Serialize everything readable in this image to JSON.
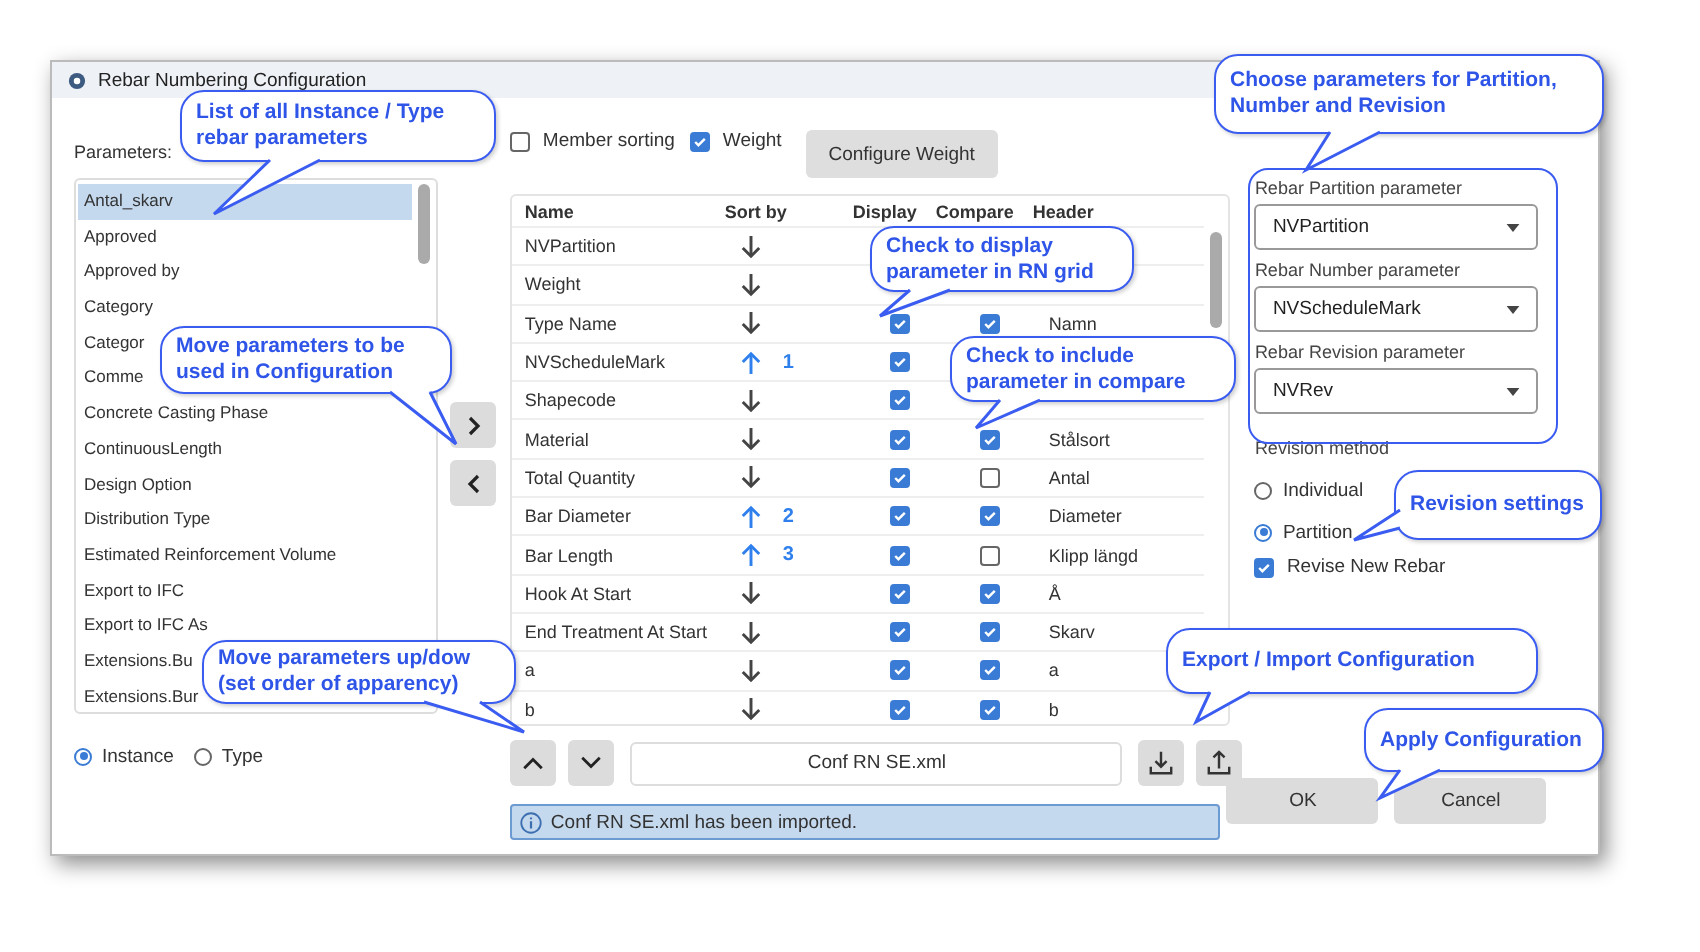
{
  "window": {
    "title": "Rebar Numbering Configuration"
  },
  "parameters": {
    "label": "Parameters:",
    "items": [
      {
        "text": "Antal_skarv",
        "selected": true
      },
      {
        "text": "Approved",
        "selected": false
      },
      {
        "text": "Approved by",
        "selected": false
      },
      {
        "text": "Category",
        "selected": false
      },
      {
        "text": "Categor",
        "selected": false
      },
      {
        "text": "Comme",
        "selected": false
      },
      {
        "text": "Concrete Casting Phase",
        "selected": false
      },
      {
        "text": "ContinuousLength",
        "selected": false
      },
      {
        "text": "Design Option",
        "selected": false
      },
      {
        "text": "Distribution Type",
        "selected": false
      },
      {
        "text": "Estimated Reinforcement Volume",
        "selected": false
      },
      {
        "text": "Export to IFC",
        "selected": false
      },
      {
        "text": "Export to IFC As",
        "selected": false
      },
      {
        "text": "Extensions.Bu",
        "selected": false
      },
      {
        "text": "Extensions.Bur",
        "selected": false
      }
    ],
    "scope": [
      {
        "label": "Instance",
        "selected": true
      },
      {
        "label": "Type",
        "selected": false
      }
    ]
  },
  "options": [
    {
      "label": "Member sorting",
      "checked": false
    },
    {
      "label": "Weight",
      "checked": true
    }
  ],
  "configure_weight": "Configure Weight",
  "grid": {
    "columns": [
      "Name",
      "Sort by",
      "Display",
      "Compare",
      "Header"
    ],
    "rows": [
      {
        "name": "NVPartition",
        "ascending": false
      },
      {
        "name": "Weight",
        "ascending": false
      },
      {
        "name": "Type Name",
        "ascending": false,
        "display": true,
        "compare": true,
        "header": "Namn"
      },
      {
        "name": "NVScheduleMark",
        "ascending": true,
        "order": "1",
        "display": true
      },
      {
        "name": "Shapecode",
        "ascending": false,
        "display": true
      },
      {
        "name": "Material",
        "ascending": false,
        "display": true,
        "compare": true,
        "header": "Stålsort"
      },
      {
        "name": "Total Quantity",
        "ascending": false,
        "display": true,
        "compare": false,
        "header": "Antal"
      },
      {
        "name": "Bar Diameter",
        "ascending": true,
        "order": "2",
        "display": true,
        "compare": true,
        "header": "Diameter"
      },
      {
        "name": "Bar Length",
        "ascending": true,
        "order": "3",
        "display": true,
        "compare": false,
        "header": "Klipp längd"
      },
      {
        "name": "Hook At Start",
        "ascending": false,
        "display": true,
        "compare": true,
        "header": "Å"
      },
      {
        "name": "End Treatment At Start",
        "ascending": false,
        "display": true,
        "compare": true,
        "header": "Skarv"
      },
      {
        "name": "a",
        "ascending": false,
        "display": true,
        "compare": true,
        "header": "a"
      },
      {
        "name": "b",
        "ascending": false,
        "display": true,
        "compare": true,
        "header": "b"
      }
    ]
  },
  "file_name": "Conf RN SE.xml",
  "status": "Conf RN SE.xml has been imported.",
  "dropdowns": [
    {
      "label": "Rebar Partition parameter",
      "value": "NVPartition"
    },
    {
      "label": "Rebar Number parameter",
      "value": "NVScheduleMark"
    },
    {
      "label": "Rebar Revision parameter",
      "value": "NVRev"
    }
  ],
  "revision": {
    "label": "Revision method",
    "options": [
      {
        "label": "Individual",
        "selected": false
      },
      {
        "label": "Partition",
        "selected": true
      }
    ],
    "revise_new": {
      "label": "Revise New Rebar",
      "checked": true
    }
  },
  "buttons": [
    "OK",
    "Cancel"
  ],
  "callouts": [
    {
      "text": "List of all Instance / Type rebar parameters"
    },
    {
      "text": "Move parameters to be used in Configuration"
    },
    {
      "text": "Move parameters up/dow (set order of apparency)"
    },
    {
      "text": "Check to display parameter in RN grid"
    },
    {
      "text": "Check to include parameter in compare"
    },
    {
      "text": "Choose parameters for Partition, Number and Revision"
    },
    {
      "text": "Revision settings"
    },
    {
      "text": "Export / Import Configuration"
    },
    {
      "text": "Apply Configuration"
    }
  ]
}
